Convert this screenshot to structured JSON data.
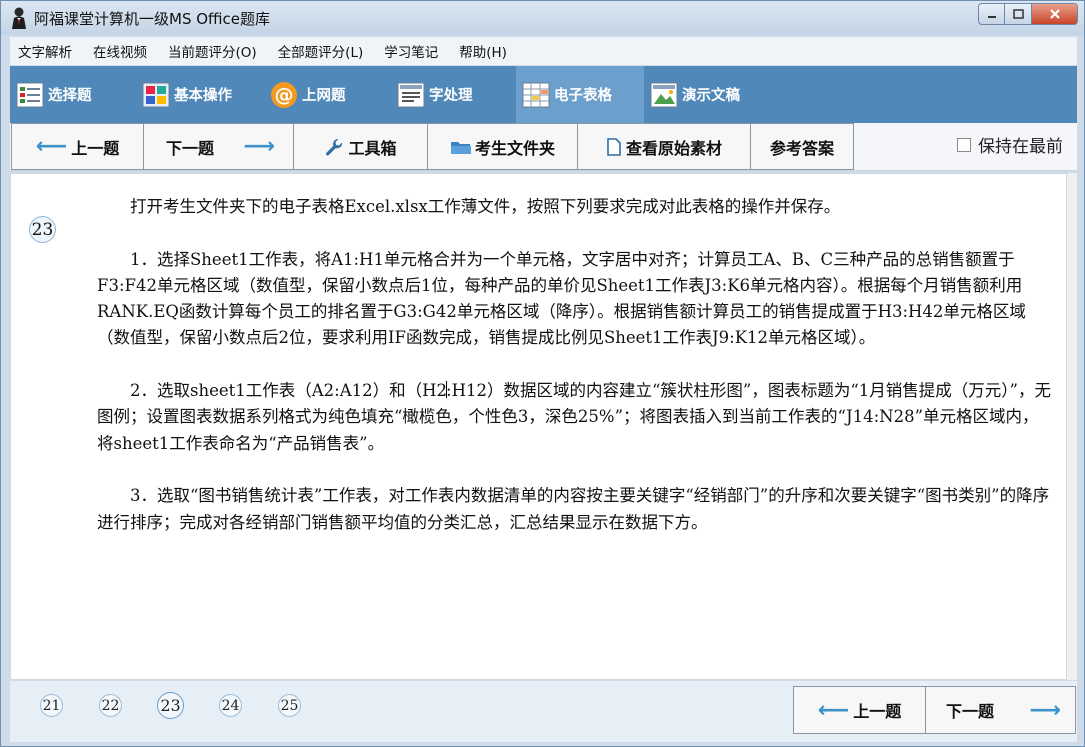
{
  "window": {
    "title": "阿福课堂计算机一级MS Office题库"
  },
  "menu": [
    "文字解析",
    "在线视频",
    "当前题评分(O)",
    "全部题评分(L)",
    "学习笔记",
    "帮助(H)"
  ],
  "modules": [
    {
      "label": "选择题",
      "icon": "checklist-icon"
    },
    {
      "label": "基本操作",
      "icon": "windows-tiles-icon"
    },
    {
      "label": "上网题",
      "icon": "at-sign-icon"
    },
    {
      "label": "字处理",
      "icon": "document-icon"
    },
    {
      "label": "电子表格",
      "icon": "spreadsheet-icon",
      "active": true
    },
    {
      "label": "演示文稿",
      "icon": "presentation-icon"
    }
  ],
  "toolbar": {
    "prev": "上一题",
    "next": "下一题",
    "tools": "工具箱",
    "folder": "考生文件夹",
    "view_material": "查看原始素材",
    "answer": "参考答案",
    "keep_on_top": "保持在最前"
  },
  "question": {
    "number": "23",
    "paragraphs": [
      "打开考生文件夹下的电子表格Excel.xlsx工作薄文件，按照下列要求完成对此表格的操作并保存。",
      "1．选择Sheet1工作表，将A1:H1单元格合并为一个单元格，文字居中对齐；计算员工A、B、C三种产品的总销售额置于F3:F42单元格区域（数值型，保留小数点后1位，每种产品的单价见Sheet1工作表J3:K6单元格内容）。根据每个月销售额利用RANK.EQ函数计算每个员工的排名置于G3:G42单元格区域（降序）。根据销售额计算员工的销售提成置于H3:H42单元格区域（数值型，保留小数点后2位，要求利用IF函数完成，销售提成比例见Sheet1工作表J9:K12单元格区域）。",
      "2．选取sheet1工作表（A2:A12）和（H2",
      ":H12）数据区域的内容建立“簇状柱形图”，图表标题为“1月销售提成（万元）”，无图例；设置图表数据系列格式为纯色填充“橄榄色，个性色3，深色25%”；将图表插入到当前工作表的“J14:N28”单元格区域内，将sheet1工作表命名为“产品销售表”。",
      "3．选取“图书销售统计表”工作表，对工作表内数据清单的内容按主要关键字“经销部门”的升序和次要关键字“图书类别”的降序进行排序；完成对各经销部门销售额平均值的分类汇总，汇总结果显示在数据下方。"
    ]
  },
  "question_nav": [
    "21",
    "22",
    "23",
    "24",
    "25"
  ],
  "current_question": "23",
  "bottom": {
    "prev": "上一题",
    "next": "下一题"
  },
  "colors": {
    "module_bar": "#4f88b9",
    "module_active": "#6d9fcd",
    "arrow": "#3d93c9"
  }
}
